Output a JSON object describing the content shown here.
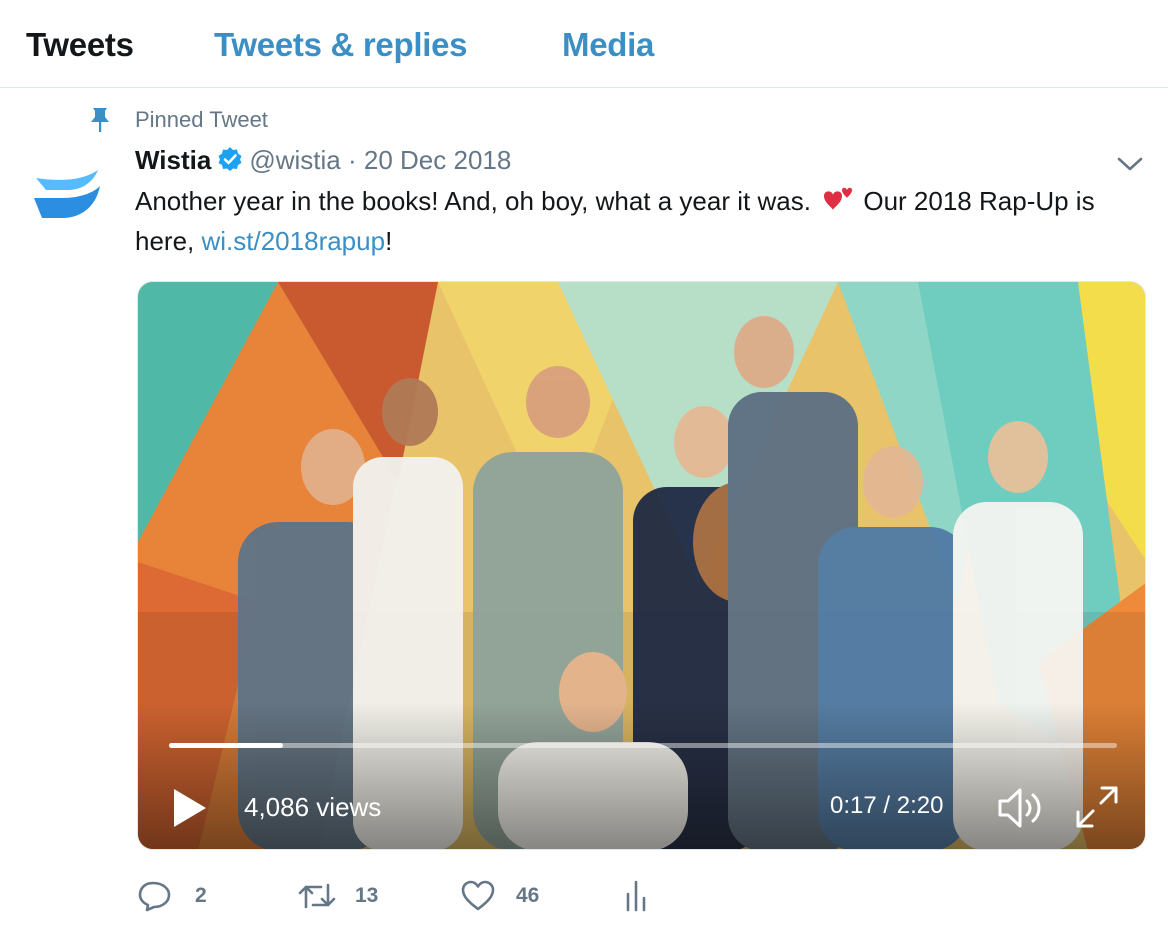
{
  "tabs": [
    {
      "label": "Tweets",
      "active": true
    },
    {
      "label": "Tweets & replies",
      "active": false
    },
    {
      "label": "Media",
      "active": false
    }
  ],
  "pinned": {
    "label": "Pinned Tweet",
    "icon": "pin-icon"
  },
  "tweet": {
    "author": "Wistia",
    "handle": "@wistia",
    "separator": "·",
    "date": "20 Dec 2018",
    "verified_icon": "verified-badge-icon",
    "text_part1": "Another year in the books! And, oh boy, what a year it was. ",
    "text_part2": " Our 2018 Rap-Up is here, ",
    "link_text": "wi.st/2018rapup",
    "text_part3": "!",
    "emoji": "two-hearts-icon"
  },
  "video": {
    "views": "4,086 views",
    "time": "0:17 / 2:20",
    "progress": 0.12,
    "controls": [
      "play-icon",
      "volume-icon",
      "fullscreen-icon"
    ]
  },
  "actions": {
    "replies": "2",
    "retweets": "13",
    "likes": "46",
    "icons": [
      "reply-icon",
      "retweet-icon",
      "like-icon",
      "analytics-icon"
    ]
  },
  "colors": {
    "accent": "#3b8fc4",
    "secondary_text": "#657786",
    "primary_text": "#14171a",
    "brand_logo": "#2b8ee0"
  }
}
